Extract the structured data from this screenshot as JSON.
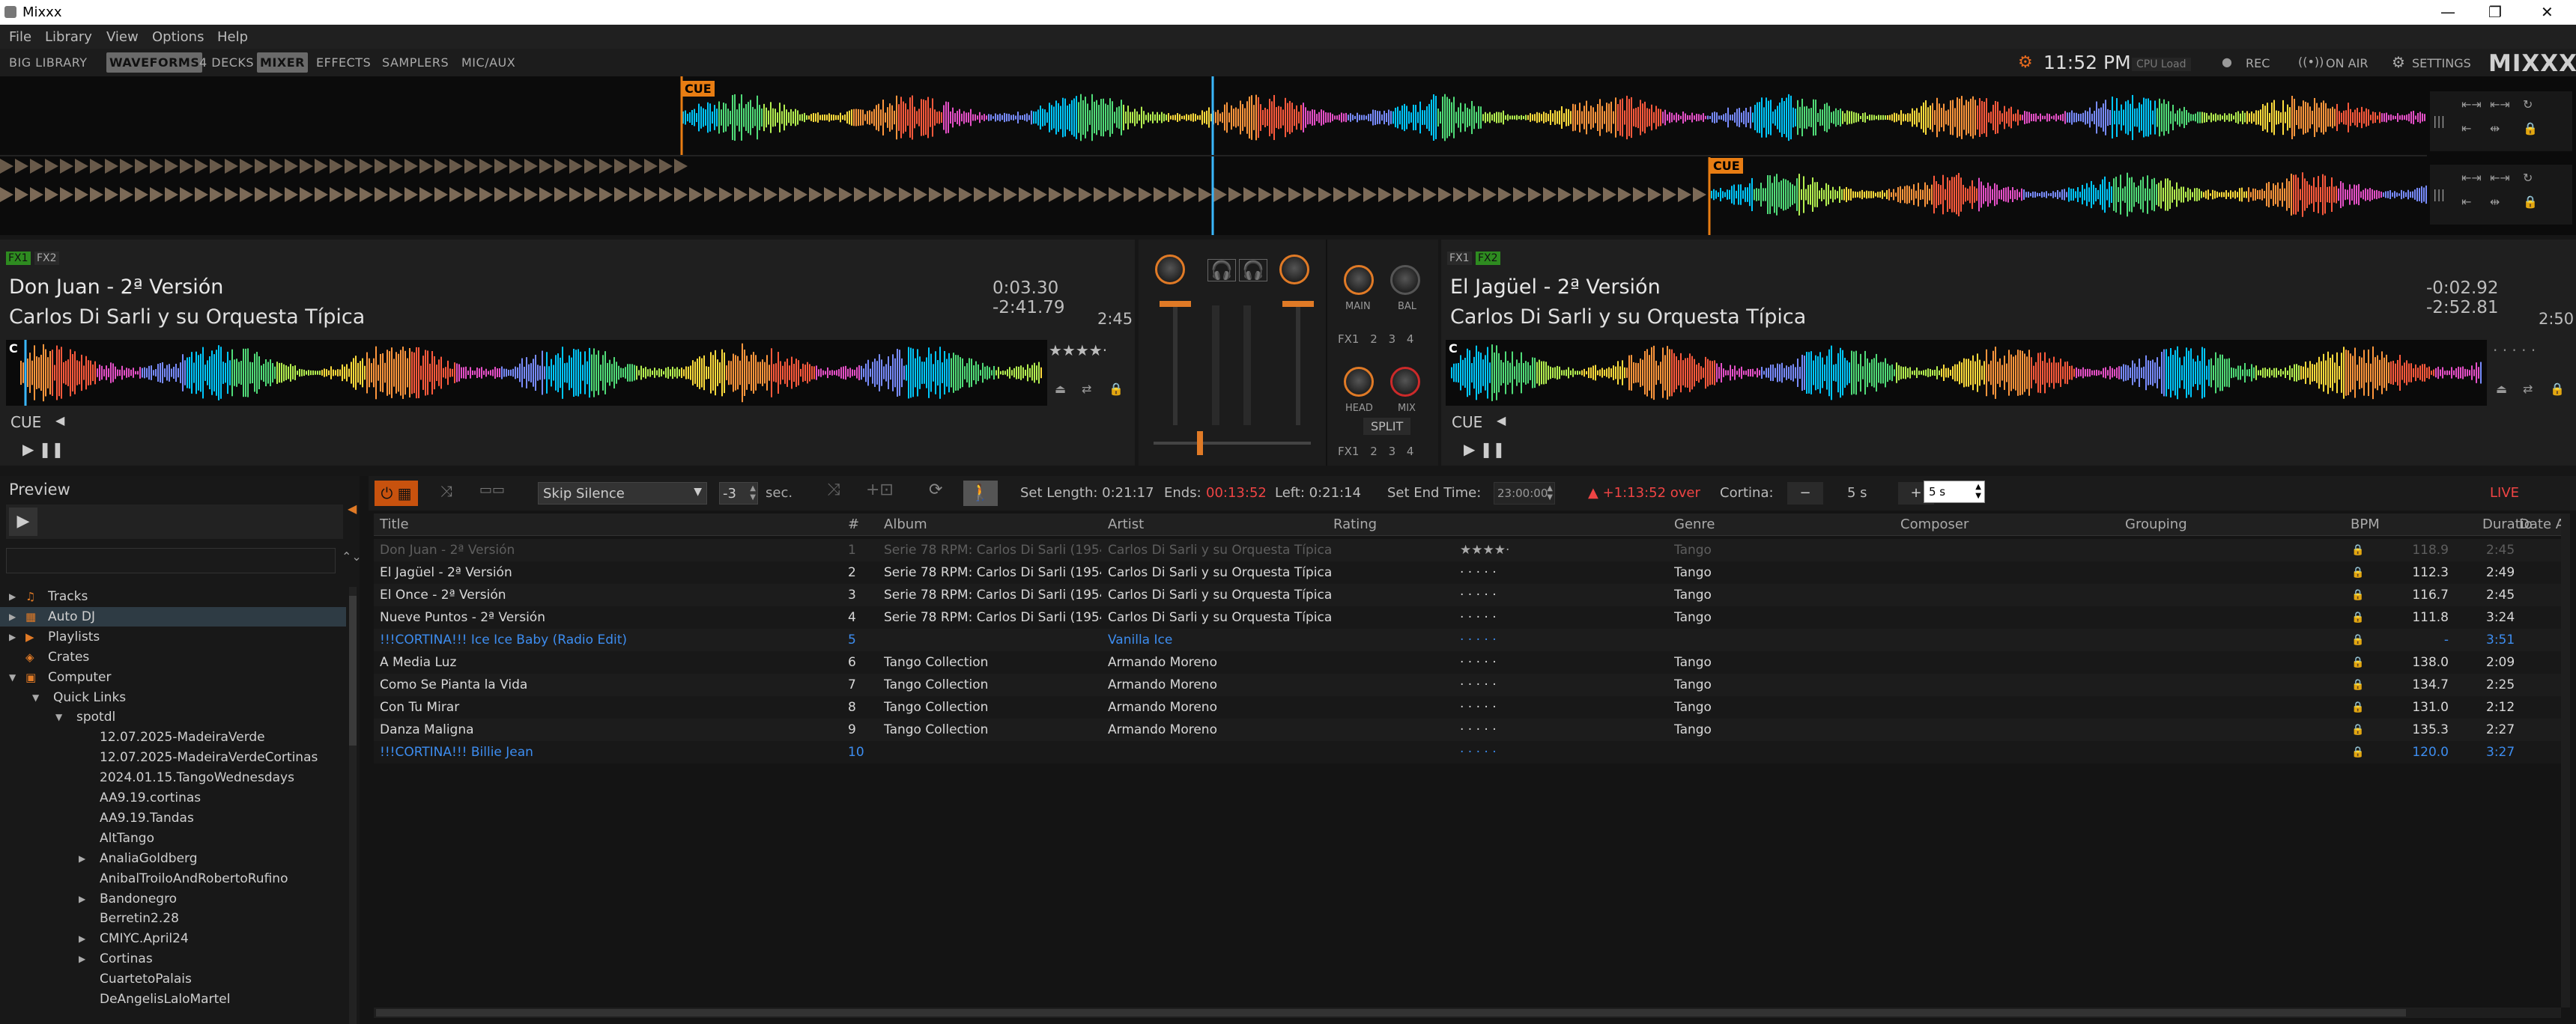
{
  "window": {
    "title": "Mixxx"
  },
  "menu": [
    "File",
    "Library",
    "View",
    "Options",
    "Help"
  ],
  "toolbar": {
    "items": [
      "BIG LIBRARY",
      "WAVEFORMS",
      "4 DECKS",
      "MIXER",
      "EFFECTS",
      "SAMPLERS",
      "MIC/AUX"
    ],
    "active": [
      "WAVEFORMS",
      "MIXER"
    ],
    "clock": "11:52 PM",
    "cpu": "CPU Load",
    "rec": "REC",
    "on_air": "ON AIR",
    "settings": "SETTINGS",
    "logo": "MIXXX"
  },
  "overview": {
    "cue1": "CUE",
    "cue2": "CUE"
  },
  "deck1": {
    "fx": [
      "FX1",
      "FX2"
    ],
    "title": "Don Juan - 2ª Versión",
    "artist": "Carlos Di Sarli y su Orquesta Típica",
    "time": "0:03.30 -2:41.79",
    "duration": "2:45",
    "cue": "CUE",
    "cue_marker": "C"
  },
  "deck2": {
    "fx": [
      "FX1",
      "FX2"
    ],
    "title": "El Jagüel - 2ª Versión",
    "artist": "Carlos Di Sarli y su Orquesta Típica",
    "time": "-0:02.92 -2:52.81",
    "duration": "2:50",
    "cue": "CUE",
    "cue_marker": "C"
  },
  "mixer": {
    "main": "MAIN",
    "bal": "BAL",
    "head": "HEAD",
    "mix": "MIX",
    "split": "SPLIT",
    "fx": [
      "FX1",
      "2",
      "3",
      "4"
    ]
  },
  "preview": {
    "label": "Preview"
  },
  "sidebar": {
    "items": [
      {
        "label": "Tracks",
        "depth": 0,
        "exp": "▶"
      },
      {
        "label": "Auto DJ",
        "depth": 0,
        "exp": "▶"
      },
      {
        "label": "Playlists",
        "depth": 0,
        "exp": "▶"
      },
      {
        "label": "Crates",
        "depth": 0,
        "exp": ""
      },
      {
        "label": "Computer",
        "depth": 0,
        "exp": "▼"
      },
      {
        "label": "Quick Links",
        "depth": 1,
        "exp": "▼"
      },
      {
        "label": "spotdl",
        "depth": 2,
        "exp": "▼"
      },
      {
        "label": "12.07.2025-MadeiraVerde",
        "depth": 3,
        "exp": ""
      },
      {
        "label": "12.07.2025-MadeiraVerdeCortinas",
        "depth": 3,
        "exp": ""
      },
      {
        "label": "2024.01.15.TangoWednesdays",
        "depth": 3,
        "exp": ""
      },
      {
        "label": "AA9.19.cortinas",
        "depth": 3,
        "exp": ""
      },
      {
        "label": "AA9.19.Tandas",
        "depth": 3,
        "exp": ""
      },
      {
        "label": "AltTango",
        "depth": 3,
        "exp": ""
      },
      {
        "label": "AnaliaGoldberg",
        "depth": 3,
        "exp": "▶"
      },
      {
        "label": "AnibalTroiloAndRobertoRufino",
        "depth": 3,
        "exp": ""
      },
      {
        "label": "Bandonegro",
        "depth": 3,
        "exp": "▶"
      },
      {
        "label": "Berretin2.28",
        "depth": 3,
        "exp": ""
      },
      {
        "label": "CMIYC.April24",
        "depth": 3,
        "exp": "▶"
      },
      {
        "label": "Cortinas",
        "depth": 3,
        "exp": "▶"
      },
      {
        "label": "CuartetoPalais",
        "depth": 3,
        "exp": ""
      },
      {
        "label": "DeAngelisLaloMartel",
        "depth": 3,
        "exp": ""
      }
    ]
  },
  "autodj": {
    "skip": "Skip Silence",
    "offset": "-3",
    "sec": "sec.",
    "set_length": "Set Length: 0:21:17",
    "ends_label": "Ends:",
    "ends_value": "00:13:52",
    "left": "Left: 0:21:14",
    "set_end_label": "Set End Time:",
    "set_end_value": "23:00:00",
    "over": "▲ +1:13:52 over",
    "cortina_label": "Cortina:",
    "cortina_value": "5 s",
    "cortina_input": "5 s",
    "live": "LIVE"
  },
  "columns": [
    "Title",
    "#",
    "Album",
    "Artist",
    "Rating",
    "Genre",
    "Composer",
    "Grouping",
    "BPM",
    "Duratio",
    "Date A"
  ],
  "rows": [
    {
      "title": "Don Juan - 2ª Versión",
      "n": "1",
      "album": "Serie 78 RPM: Carlos Di Sarli (1954...",
      "artist": "Carlos Di Sarli y su Orquesta Típica",
      "rating": "★★★★·",
      "genre": "Tango",
      "bpm": "118.9",
      "dur": "2:45",
      "style": "played"
    },
    {
      "title": "El Jagüel - 2ª Versión",
      "n": "2",
      "album": "Serie 78 RPM: Carlos Di Sarli (1954...",
      "artist": "Carlos Di Sarli y su Orquesta Típica",
      "rating": "· · · · ·",
      "genre": "Tango",
      "bpm": "112.3",
      "dur": "2:49",
      "style": "normal"
    },
    {
      "title": "El Once - 2ª Versión",
      "n": "3",
      "album": "Serie 78 RPM: Carlos Di Sarli (1954...",
      "artist": "Carlos Di Sarli y su Orquesta Típica",
      "rating": "· · · · ·",
      "genre": "Tango",
      "bpm": "116.7",
      "dur": "2:45",
      "style": "normal"
    },
    {
      "title": "Nueve Puntos - 2ª Versión",
      "n": "4",
      "album": "Serie 78 RPM: Carlos Di Sarli (1954...",
      "artist": "Carlos Di Sarli y su Orquesta Típica",
      "rating": "· · · · ·",
      "genre": "Tango",
      "bpm": "111.8",
      "dur": "3:24",
      "style": "normal"
    },
    {
      "title": "!!!CORTINA!!! Ice Ice Baby (Radio Edit)",
      "n": "5",
      "album": "",
      "artist": "Vanilla Ice",
      "rating": "· · · · ·",
      "genre": "",
      "bpm": "-",
      "dur": "3:51",
      "style": "cortina"
    },
    {
      "title": "A Media Luz",
      "n": "6",
      "album": "Tango Collection",
      "artist": "Armando Moreno",
      "rating": "· · · · ·",
      "genre": "Tango",
      "bpm": "138.0",
      "dur": "2:09",
      "style": "normal"
    },
    {
      "title": "Como Se Pianta la Vida",
      "n": "7",
      "album": "Tango Collection",
      "artist": "Armando Moreno",
      "rating": "· · · · ·",
      "genre": "Tango",
      "bpm": "134.7",
      "dur": "2:25",
      "style": "normal"
    },
    {
      "title": "Con Tu Mirar",
      "n": "8",
      "album": "Tango Collection",
      "artist": "Armando Moreno",
      "rating": "· · · · ·",
      "genre": "Tango",
      "bpm": "131.0",
      "dur": "2:12",
      "style": "normal"
    },
    {
      "title": "Danza Maligna",
      "n": "9",
      "album": "Tango Collection",
      "artist": "Armando Moreno",
      "rating": "· · · · ·",
      "genre": "Tango",
      "bpm": "135.3",
      "dur": "2:27",
      "style": "normal"
    },
    {
      "title": "!!!CORTINA!!! Billie Jean",
      "n": "10",
      "album": "",
      "artist": "",
      "rating": "· · · · ·",
      "genre": "",
      "bpm": "120.0",
      "dur": "3:27",
      "style": "cortina"
    }
  ]
}
